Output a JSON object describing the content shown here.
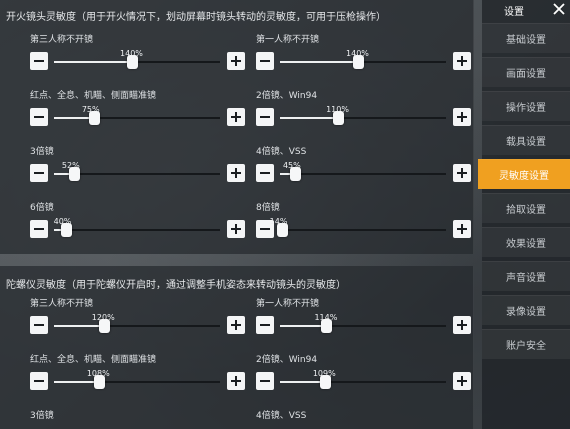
{
  "sidebar": {
    "title": "设置",
    "close_icon": "close-icon",
    "items": [
      {
        "label": "基础设置",
        "active": false
      },
      {
        "label": "画面设置",
        "active": false
      },
      {
        "label": "操作设置",
        "active": false
      },
      {
        "label": "载具设置",
        "active": false
      },
      {
        "label": "灵敏度设置",
        "active": true
      },
      {
        "label": "拾取设置",
        "active": false
      },
      {
        "label": "效果设置",
        "active": false
      },
      {
        "label": "声音设置",
        "active": false
      },
      {
        "label": "录像设置",
        "active": false
      },
      {
        "label": "账户安全",
        "active": false
      }
    ]
  },
  "fire_section": {
    "title": "开火镜头灵敏度（用于开火情况下，划动屏幕时镜头转动的灵敏度，可用于压枪操作）",
    "sliders": [
      {
        "label": "第三人称不开镜",
        "value_text": "140%",
        "level": 0.47
      },
      {
        "label": "第一人称不开镜",
        "value_text": "140%",
        "level": 0.47
      },
      {
        "label": "红点、全息、机瞄、侧面瞄准镜",
        "value_text": "75%",
        "level": 0.24
      },
      {
        "label": "2倍镜、Win94",
        "value_text": "110%",
        "level": 0.35
      },
      {
        "label": "3倍镜",
        "value_text": "52%",
        "level": 0.12
      },
      {
        "label": "4倍镜、VSS",
        "value_text": "45%",
        "level": 0.09
      },
      {
        "label": "6倍镜",
        "value_text": "40%",
        "level": 0.07
      },
      {
        "label": "8倍镜",
        "value_text": "14%",
        "level": 0.01
      }
    ]
  },
  "gyro_section": {
    "title": "陀螺仪灵敏度（用于陀螺仪开启时，通过调整手机姿态来转动镜头的灵敏度）",
    "sliders": [
      {
        "label": "第三人称不开镜",
        "value_text": "120%",
        "level": 0.3
      },
      {
        "label": "第一人称不开镜",
        "value_text": "114%",
        "level": 0.28
      },
      {
        "label": "红点、全息、机瞄、侧面瞄准镜",
        "value_text": "108%",
        "level": 0.27
      },
      {
        "label": "2倍镜、Win94",
        "value_text": "109%",
        "level": 0.27
      },
      {
        "label": "3倍镜",
        "value_text": "",
        "level": null
      },
      {
        "label": "4倍镜、VSS",
        "value_text": "",
        "level": null
      }
    ]
  },
  "icons": {
    "minus": "minus-icon",
    "plus": "plus-icon",
    "close": "close-icon"
  },
  "colors": {
    "accent": "#f0a020",
    "panel": "#262a2e",
    "button": "#f4f5f6"
  }
}
